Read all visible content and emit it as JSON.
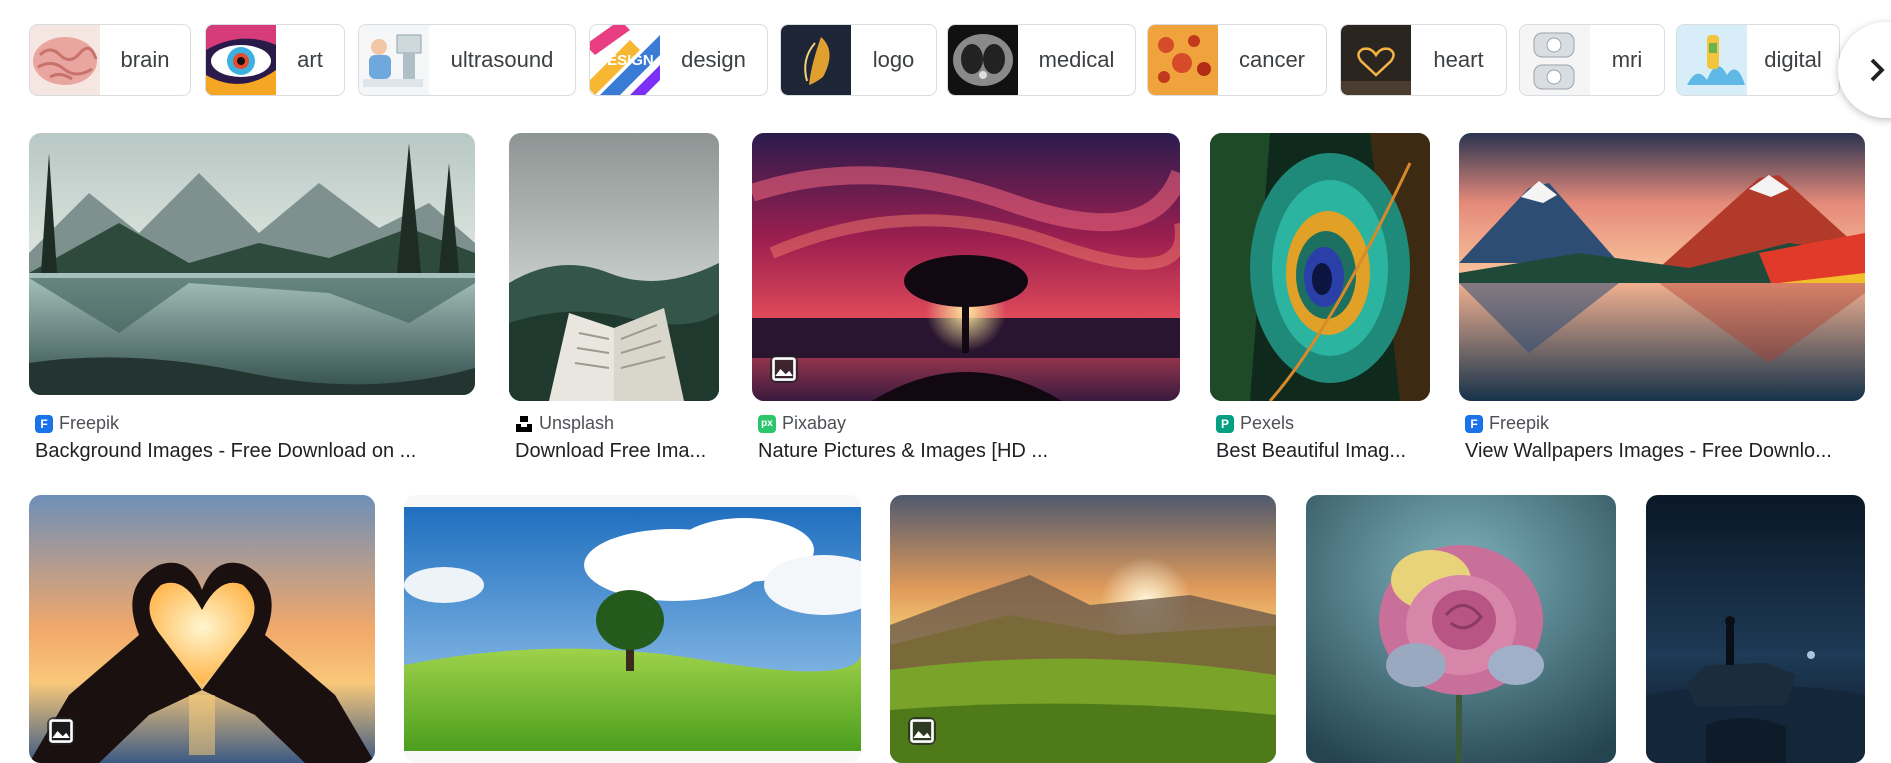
{
  "chips": [
    {
      "label": "brain",
      "icon": "brain-thumbnail"
    },
    {
      "label": "art",
      "icon": "eye-art-thumbnail"
    },
    {
      "label": "ultrasound",
      "icon": "ultrasound-thumbnail"
    },
    {
      "label": "design",
      "icon": "design-thumbnail",
      "thumb_text": "DESIGN"
    },
    {
      "label": "logo",
      "icon": "feather-logo-thumbnail"
    },
    {
      "label": "medical",
      "icon": "lung-scan-thumbnail"
    },
    {
      "label": "cancer",
      "icon": "cells-thumbnail"
    },
    {
      "label": "heart",
      "icon": "light-heart-thumbnail"
    },
    {
      "label": "mri",
      "icon": "mri-machine-thumbnail"
    },
    {
      "label": "digital",
      "icon": "splash-thumbnail"
    }
  ],
  "next_button_icon": "chevron-right-icon",
  "results_row1": [
    {
      "source": "Freepik",
      "title": "Background Images - Free Download on ...",
      "favicon_color": "#1a73e8",
      "scene": "mountain-lake"
    },
    {
      "source": "Unsplash",
      "title": "Download Free Ima...",
      "favicon_color": "#000000",
      "scene": "open-book-forest"
    },
    {
      "source": "Pixabay",
      "title": "Nature Pictures & Images [HD ...",
      "favicon_color": "#2ec66d",
      "favicon_text": "px",
      "scene": "tree-sunset",
      "badge": "image-icon"
    },
    {
      "source": "Pexels",
      "title": "Best Beautiful Imag...",
      "favicon_color": "#05a081",
      "favicon_text": "P",
      "scene": "peacock-feather"
    },
    {
      "source": "Freepik",
      "title": "View Wallpapers Images - Free Downlo...",
      "favicon_color": "#1a73e8",
      "scene": "volcano-lake"
    }
  ],
  "results_row2": [
    {
      "scene": "heart-hands-sunset",
      "badge": "image-icon"
    },
    {
      "scene": "green-field-tree"
    },
    {
      "scene": "sunset-meadow",
      "badge": "image-icon"
    },
    {
      "scene": "pink-rose"
    },
    {
      "scene": "night-figure-rock"
    }
  ]
}
